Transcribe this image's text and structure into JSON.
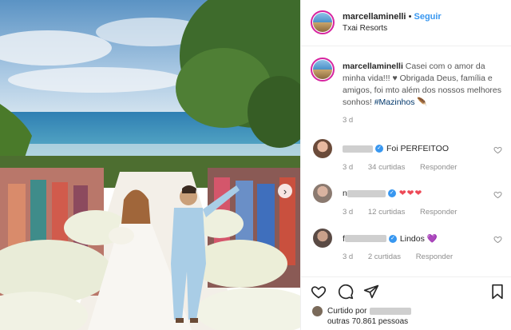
{
  "colors": {
    "accent": "#3897f0",
    "muted": "#8e8e8e",
    "text": "#262626",
    "heart_red": "#ed4956",
    "heart_purple": "#9b5de5"
  },
  "post": {
    "author": "marcellaminelli",
    "separator": "•",
    "follow_label": "Seguir",
    "location": "Txai Resorts"
  },
  "caption": {
    "author": "marcellaminelli",
    "text": "Casei com o amor da minha vida!!! ♥ Obrigada Deus, família e amigos, foi mto além dos nossos melhores sonhos!",
    "hashtag": "#Mazinhos",
    "emoji": "🪶",
    "time": "3 d"
  },
  "comments": [
    {
      "text": "Foi PERFEITOO",
      "time": "3 d",
      "likes": "34 curtidas",
      "reply": "Responder"
    },
    {
      "text": "❤❤❤",
      "time": "3 d",
      "likes": "12 curtidas",
      "reply": "Responder"
    },
    {
      "text": "Lindos 💜",
      "time": "3 d",
      "likes": "2 curtidas",
      "reply": "Responder"
    }
  ],
  "footer": {
    "liked_by": "Curtido por",
    "others": "outras 70.861 pessoas"
  },
  "icons": {
    "like": "heart-outline-icon",
    "comment": "speech-bubble-icon",
    "share": "paper-plane-icon",
    "save": "bookmark-icon",
    "next": "chevron-right-icon"
  }
}
